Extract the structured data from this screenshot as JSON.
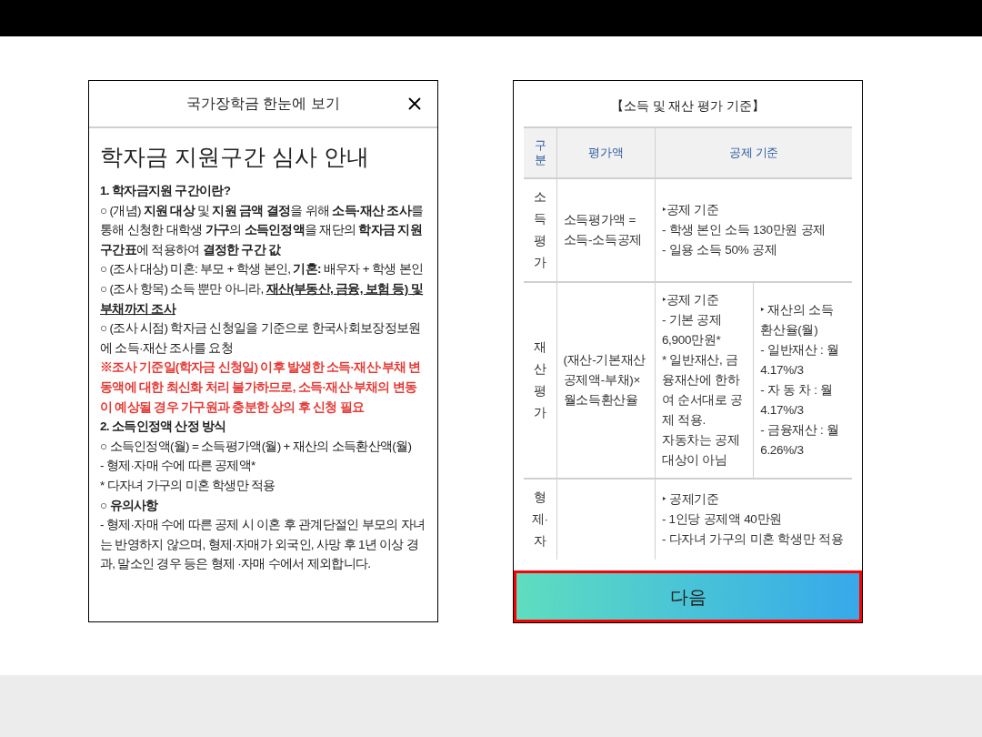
{
  "left_panel": {
    "header_title": "국가장학금 한눈에 보기",
    "page_title": "학자금 지원구간 심사 안내",
    "paragraphs": [
      {
        "kind": "heading",
        "text": "1. **학자금지원 구간**이란?"
      },
      {
        "kind": "text",
        "text": "○ (개념) **지원 대상** 및 **지원 금액 결정**을 위해 **소득·재산 조사**를 통해 신청한 대학생 **가구**의 **소득인정액**을 재단의 **학자금 지원구간표**에 적용하여 **결정한 구간 값**"
      },
      {
        "kind": "text",
        "text": "○ (조사 대상) 미혼: 부모 + 학생 본인, **기혼:** 배우자 + 학생 본인"
      },
      {
        "kind": "text",
        "text": "○ (조사 항목) 소득 뿐만 아니라, ",
        "underlined": "재산(부동산, 금융, 보험 등) 및 부채까지 조사"
      },
      {
        "kind": "text",
        "text": "○ (조사 시점) 학자금 신청일을 기준으로 한국사회보장정보원에 소득·재산 조사를 요청"
      },
      {
        "kind": "warning",
        "text": "※조사 기준일(학자금 신청일) 이후 발생한 소득·재산·부채 변동액에 대한 최신화 처리 불가하므로, 소득·재산·부채의 변동이 예상될 경우 가구원과 충분한 상의 후 신청 필요"
      },
      {
        "kind": "heading",
        "text": "2. 소득인정액 산정 방식"
      },
      {
        "kind": "text",
        "text": "○ 소득인정액(월) = 소득평가액(월) + 재산의 소득환산액(월)"
      },
      {
        "kind": "text",
        "text": "- 형제·자매 수에 따른 공제액*"
      },
      {
        "kind": "text",
        "text": "* 다자녀 가구의 미혼 학생만 적용"
      },
      {
        "kind": "heading",
        "text": "○ 유의사항"
      },
      {
        "kind": "text",
        "text": "- 형제·자매 수에 따른 공제 시 이혼 후 관계단절인 부모의 자녀는 반영하지 않으며, 형제·자매가 외국인, 사망 후 1년 이상 경과, 말소인 경우 등은 형제 ·자매 수에서 제외합니다."
      }
    ]
  },
  "right_panel": {
    "table_title": "【소득 및 재산 평가 기준】",
    "columns": [
      "구분",
      "평가액",
      "공제 기준"
    ],
    "rows": [
      {
        "category": "소득평가",
        "amount": "소득평가액 = 소득-소득공제",
        "criteria": [
          [
            "‣공제 기준",
            "- 학생 본인 소득 130만원 공제",
            "- 일용 소득 50% 공제"
          ]
        ]
      },
      {
        "category": "재산평가",
        "amount": "(재산-기본재산공제액-부채)×월소득환산율",
        "criteria": [
          [
            "‣공제 기준",
            "- 기본 공제 6,900만원*",
            "* 일반재산, 금융재산에 한하여 순서대로 공제 적용.",
            "자동차는 공제 대상이 아님"
          ],
          [
            "‣ 재산의 소득 환산율(월)",
            "- 일반재산 : 월 4.17%/3",
            "- 자 동 차 : 월 4.17%/3",
            "- 금융재산 : 월 6.26%/3"
          ]
        ]
      },
      {
        "category": "형제·자",
        "criteria": [
          [
            "‣ 공제기준",
            "- 1인당 공제액 40만원",
            "- 다자녀 가구의 미혼 학생만 적용"
          ]
        ]
      }
    ],
    "next_button": "다음"
  }
}
